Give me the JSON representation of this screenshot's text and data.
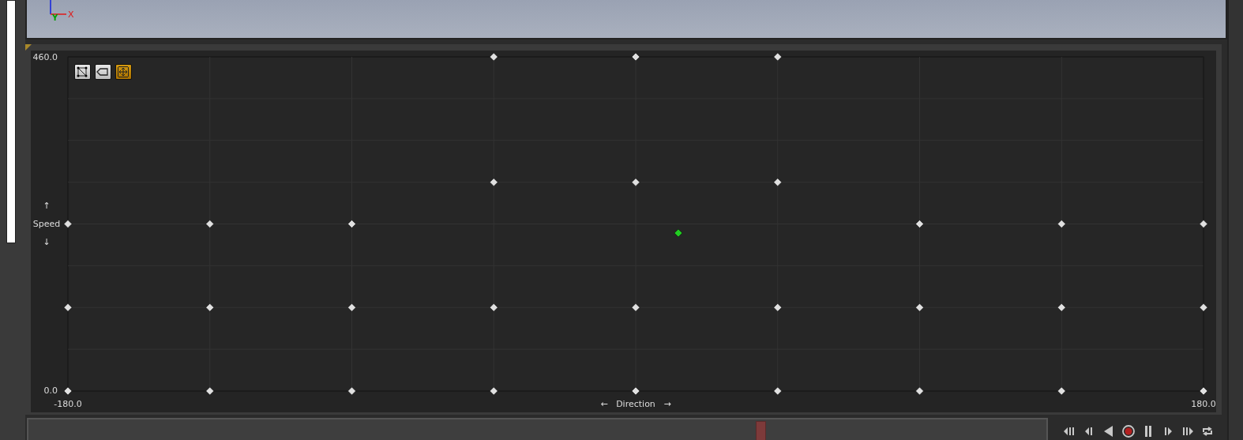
{
  "viewport": {
    "axis_labels": [
      "X",
      "Y"
    ]
  },
  "blend_space": {
    "toolbar": [
      {
        "kind": "triangulation",
        "selected": false
      },
      {
        "kind": "label",
        "selected": false
      },
      {
        "kind": "fit",
        "selected": true
      }
    ],
    "chart_data": {
      "type": "scatter",
      "xlabel": "Direction",
      "ylabel": "Speed",
      "xlim": [
        -180,
        180
      ],
      "ylim": [
        0,
        460
      ],
      "xticks": [
        {
          "value": -180,
          "label": "-180.0"
        },
        {
          "value": 180,
          "label": "180.0"
        }
      ],
      "yticks": [
        {
          "value": 0,
          "label": "0.0"
        },
        {
          "value": 460,
          "label": "460.0"
        }
      ],
      "series": [
        {
          "color": "#e0e0e0",
          "x": [
            -45,
            0,
            45,
            -45,
            0,
            45,
            -180,
            -135,
            -90,
            90,
            135,
            180,
            -180,
            -135,
            -90,
            -45,
            0,
            45,
            90,
            135,
            180,
            -180,
            -135,
            -90,
            -45,
            0,
            45,
            90,
            135,
            180
          ],
          "values": [
            460,
            460,
            460,
            287.5,
            287.5,
            287.5,
            230,
            230,
            230,
            230,
            230,
            230,
            115,
            115,
            115,
            115,
            115,
            115,
            115,
            115,
            115,
            0,
            0,
            0,
            0,
            0,
            0,
            0,
            0,
            0
          ]
        },
        {
          "color": "#22cc22",
          "x": [
            13.5
          ],
          "values": [
            217.5
          ]
        }
      ]
    },
    "x_arrows": [
      "←",
      "→"
    ],
    "y_arrows": [
      "↑",
      "↓"
    ]
  },
  "timeline": {
    "level": 0.72
  },
  "transport": [
    {
      "kind": "first"
    },
    {
      "kind": "step_back"
    },
    {
      "kind": "reverse"
    },
    {
      "kind": "record"
    },
    {
      "kind": "pause"
    },
    {
      "kind": "step_forward"
    },
    {
      "kind": "last"
    },
    {
      "kind": "loop"
    }
  ]
}
